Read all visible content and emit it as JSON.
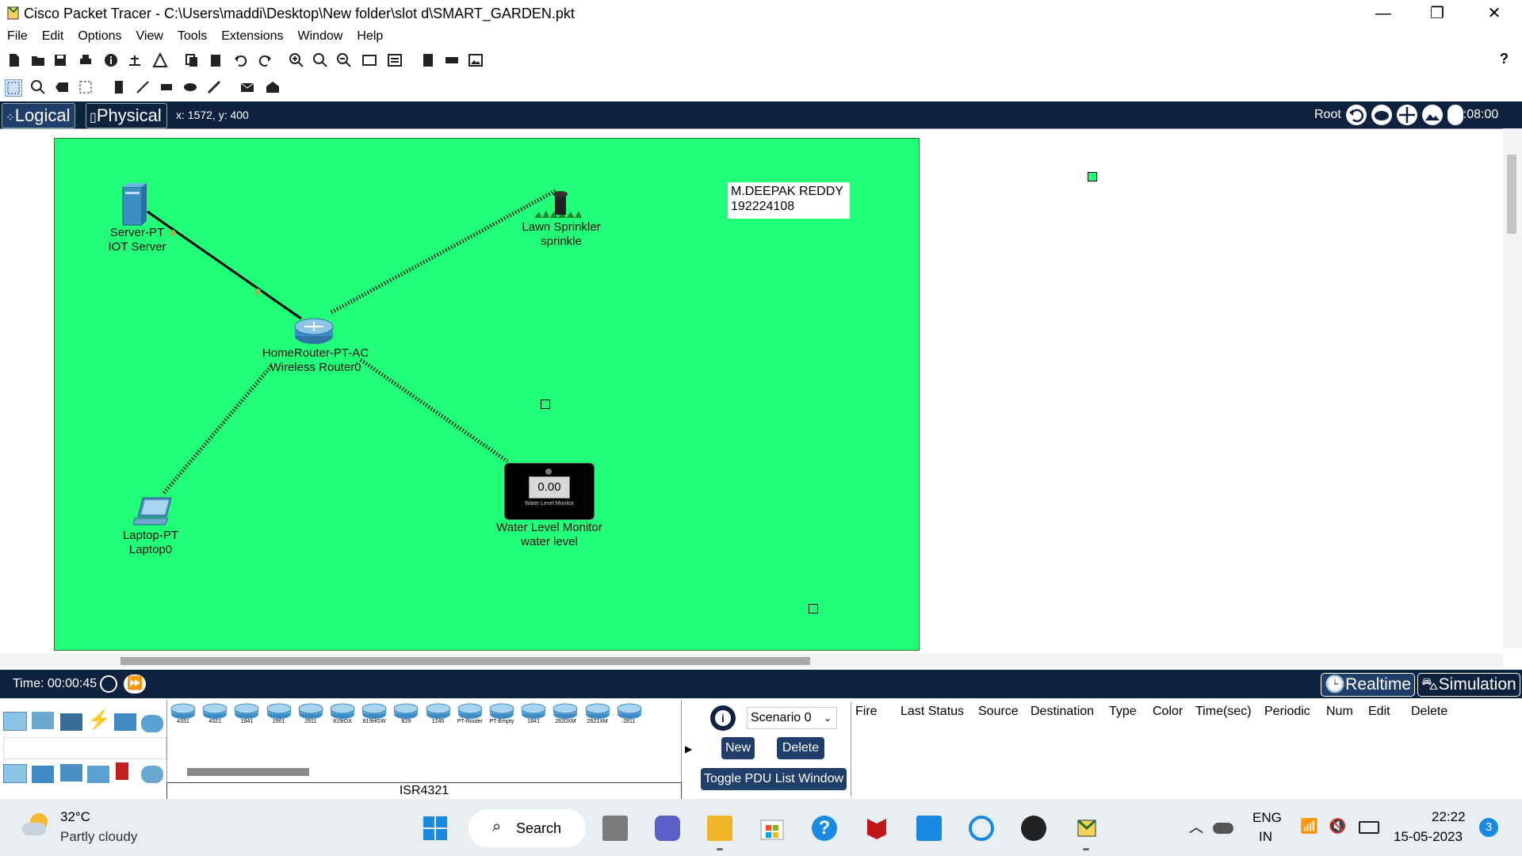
{
  "window": {
    "title": "Cisco Packet Tracer - C:\\Users\\maddi\\Desktop\\New folder\\slot d\\SMART_GARDEN.pkt",
    "minimize": "—",
    "maximize": "❐",
    "close": "✕"
  },
  "menu": [
    "File",
    "Edit",
    "Options",
    "View",
    "Tools",
    "Extensions",
    "Window",
    "Help"
  ],
  "toolbar_help": "?",
  "nav": {
    "logical_tab": "Logical",
    "physical_tab": "Physical",
    "coords": "x: 1572, y: 400",
    "root": "Root",
    "clock": "00:08:00"
  },
  "devices": {
    "server": {
      "type": "Server-PT",
      "name": "IOT Server"
    },
    "sprinkler": {
      "type": "Lawn Sprinkler",
      "name": "sprinkle"
    },
    "router": {
      "type": "HomeRouter-PT-AC",
      "name": "Wireless Router0"
    },
    "laptop": {
      "type": "Laptop-PT",
      "name": "Laptop0"
    },
    "water_monitor": {
      "type": "Water Level Monitor",
      "name": "water level",
      "reading": "0.00",
      "screen_label": "Water Level Monitor"
    }
  },
  "note": {
    "line1": "M.DEEPAK REDDY",
    "line2": "192224108"
  },
  "timebar": {
    "time": "Time: 00:00:45",
    "realtime": "Realtime",
    "simulation": "Simulation"
  },
  "models": [
    "4331",
    "4321",
    "1941",
    "2901",
    "2911",
    "819IOX",
    "819HGW",
    "829",
    "1240",
    "PT-Router",
    "PT-Empty",
    "1841",
    "2620XM",
    "2621XM",
    "2811"
  ],
  "selected_model": "ISR4321",
  "scenario": {
    "selected": "Scenario 0",
    "new": "New",
    "delete": "Delete",
    "toggle": "Toggle PDU List Window"
  },
  "pdu_columns": [
    "Fire",
    "Last Status",
    "Source",
    "Destination",
    "Type",
    "Color",
    "Time(sec)",
    "Periodic",
    "Num",
    "Edit",
    "Delete"
  ],
  "taskbar": {
    "temp": "32°C",
    "weather": "Partly cloudy",
    "search": "Search",
    "lang1": "ENG",
    "lang2": "IN",
    "time": "22:22",
    "date": "15-05-2023",
    "badge": "3"
  },
  "colors": {
    "canvas": "#23fe78",
    "navbar": "#0e2240",
    "accent": "#1f3f6a"
  }
}
